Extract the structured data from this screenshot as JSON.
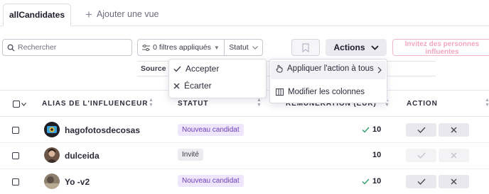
{
  "tabs": {
    "active": "allCandidates",
    "add_view": "Ajouter une vue"
  },
  "toolbar": {
    "search_placeholder": "Rechercher",
    "filters_label": "0 filtres appliqués",
    "status_filter": "Statut",
    "actions_label": "Actions",
    "invite_label": "Invitez des personnes influentes",
    "source_label": "Source"
  },
  "status_menu": {
    "items": [
      {
        "label": "Accepter",
        "icon": "check-icon"
      },
      {
        "label": "Écarter",
        "icon": "close-icon"
      }
    ]
  },
  "actions_menu": {
    "items": [
      {
        "label": "Appliquer l'action à tous",
        "icon": "pointer-hand-icon"
      },
      {
        "label": "Modifier les colonnes",
        "icon": "columns-icon"
      }
    ]
  },
  "table": {
    "headers": {
      "alias": "ALIAS DE L'INFLUENCEUR",
      "status": "STATUT",
      "score": "RÉMUNÉRATION (EUR)",
      "action": "ACTION"
    },
    "rows": [
      {
        "alias": "hagofotosdecosas",
        "status": "Nouveau candidat",
        "status_type": "new",
        "score": "10",
        "score_check": true,
        "actions_enabled": true
      },
      {
        "alias": "dulceida",
        "status": "Invité",
        "status_type": "invited",
        "score": "10",
        "score_check": false,
        "actions_enabled": false
      },
      {
        "alias": "Yo -v2",
        "status": "Nouveau candidat",
        "status_type": "new",
        "score": "10",
        "score_check": true,
        "actions_enabled": true
      }
    ]
  },
  "colors": {
    "accent_purple": "#6b3fb8",
    "badge_new_bg": "#efe6fc",
    "invite_pink": "#f2a7c1",
    "check_green": "#2e9e6a"
  }
}
